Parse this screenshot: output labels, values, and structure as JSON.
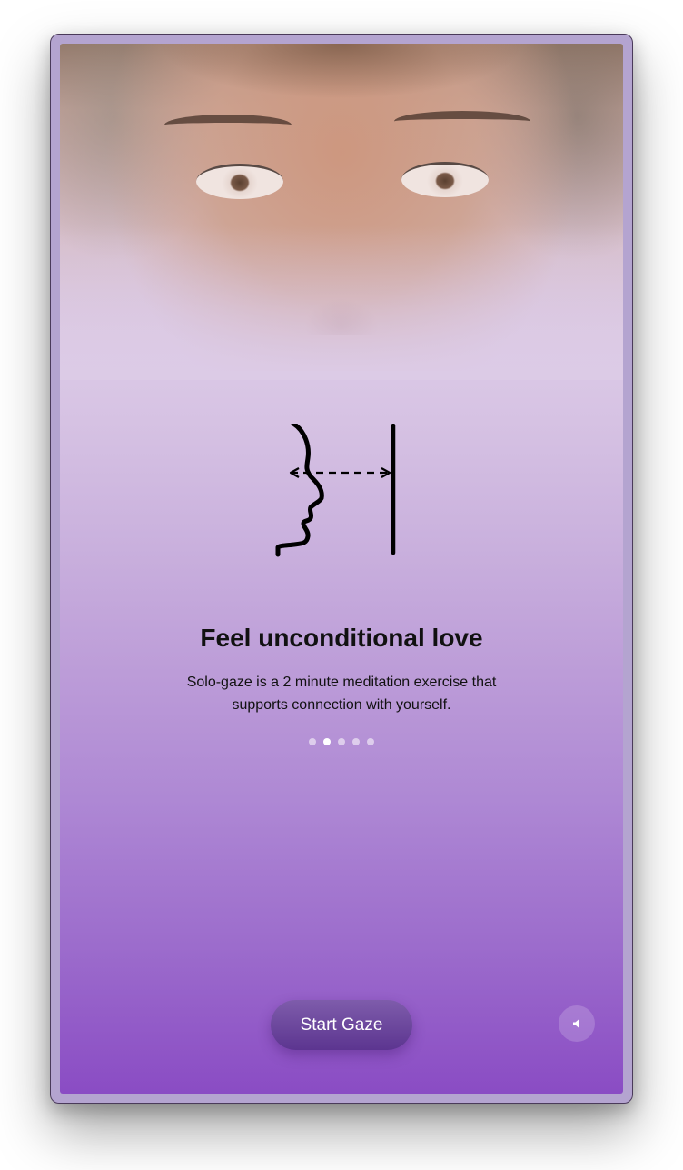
{
  "screen": {
    "title": "Feel unconditional love",
    "description": "Solo-gaze is a 2 minute meditation exercise that supports connection with yourself.",
    "pagination": {
      "total": 5,
      "active_index": 1
    }
  },
  "actions": {
    "start_label": "Start Gaze",
    "sound_icon": "speaker-muted-icon"
  },
  "illustration": {
    "icon": "face-profile-gazing-at-mirror-icon"
  },
  "colors": {
    "gradient_top": "#dccbe6",
    "gradient_bottom": "#8a4cc4",
    "button": "#6a4498",
    "text": "#111111"
  }
}
